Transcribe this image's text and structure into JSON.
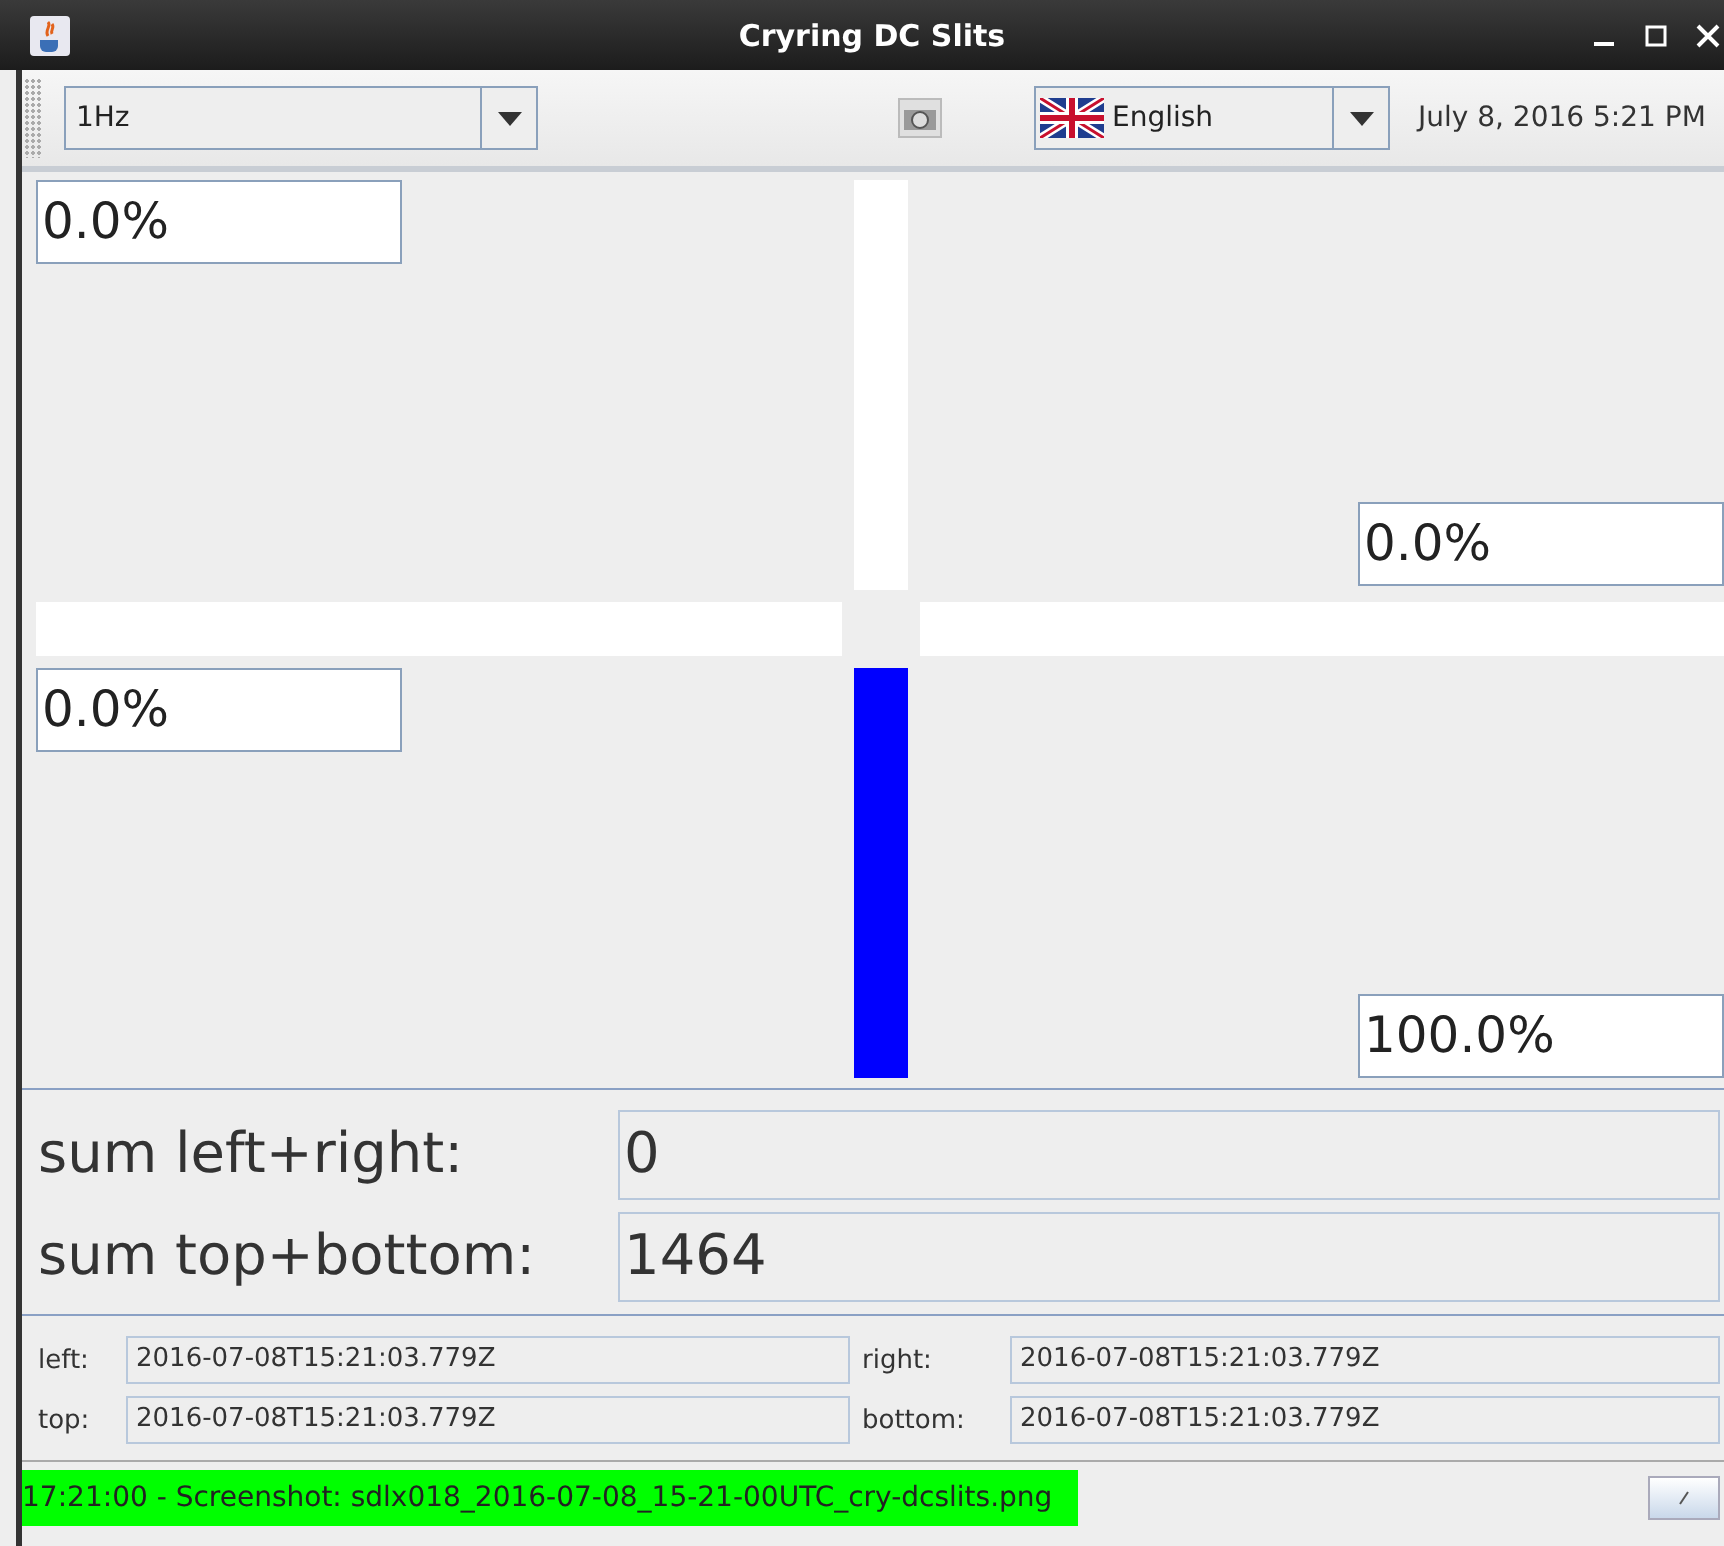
{
  "window": {
    "title": "Cryring DC Slits"
  },
  "toolbar": {
    "rate": "1Hz",
    "language": "English",
    "datetime": "July 8, 2016 5:21 PM"
  },
  "slits": [
    {
      "kind": "top",
      "level": 0.0,
      "reading": "0.0%"
    },
    {
      "kind": "right",
      "level": 0.0,
      "reading": "0.0%"
    },
    {
      "kind": "left",
      "level": 0.0,
      "reading": "0.0%"
    },
    {
      "kind": "bottom",
      "level": 1.0,
      "reading": "100.0%"
    }
  ],
  "sums": [
    {
      "label": "sum left+right:",
      "value": "0"
    },
    {
      "label": "sum top+bottom:",
      "value": "1464"
    }
  ],
  "timestamps": [
    {
      "label": "left:",
      "value": "2016-07-08T15:21:03.779Z"
    },
    {
      "label": "right:",
      "value": "2016-07-08T15:21:03.779Z"
    },
    {
      "label": "top:",
      "value": "2016-07-08T15:21:03.779Z"
    },
    {
      "label": "bottom:",
      "value": "2016-07-08T15:21:03.779Z"
    }
  ],
  "status_bar": {
    "message": "17:21:00 - Screenshot: sdlx018_2016-07-08_15-21-00UTC_cry-dcslits.png"
  }
}
